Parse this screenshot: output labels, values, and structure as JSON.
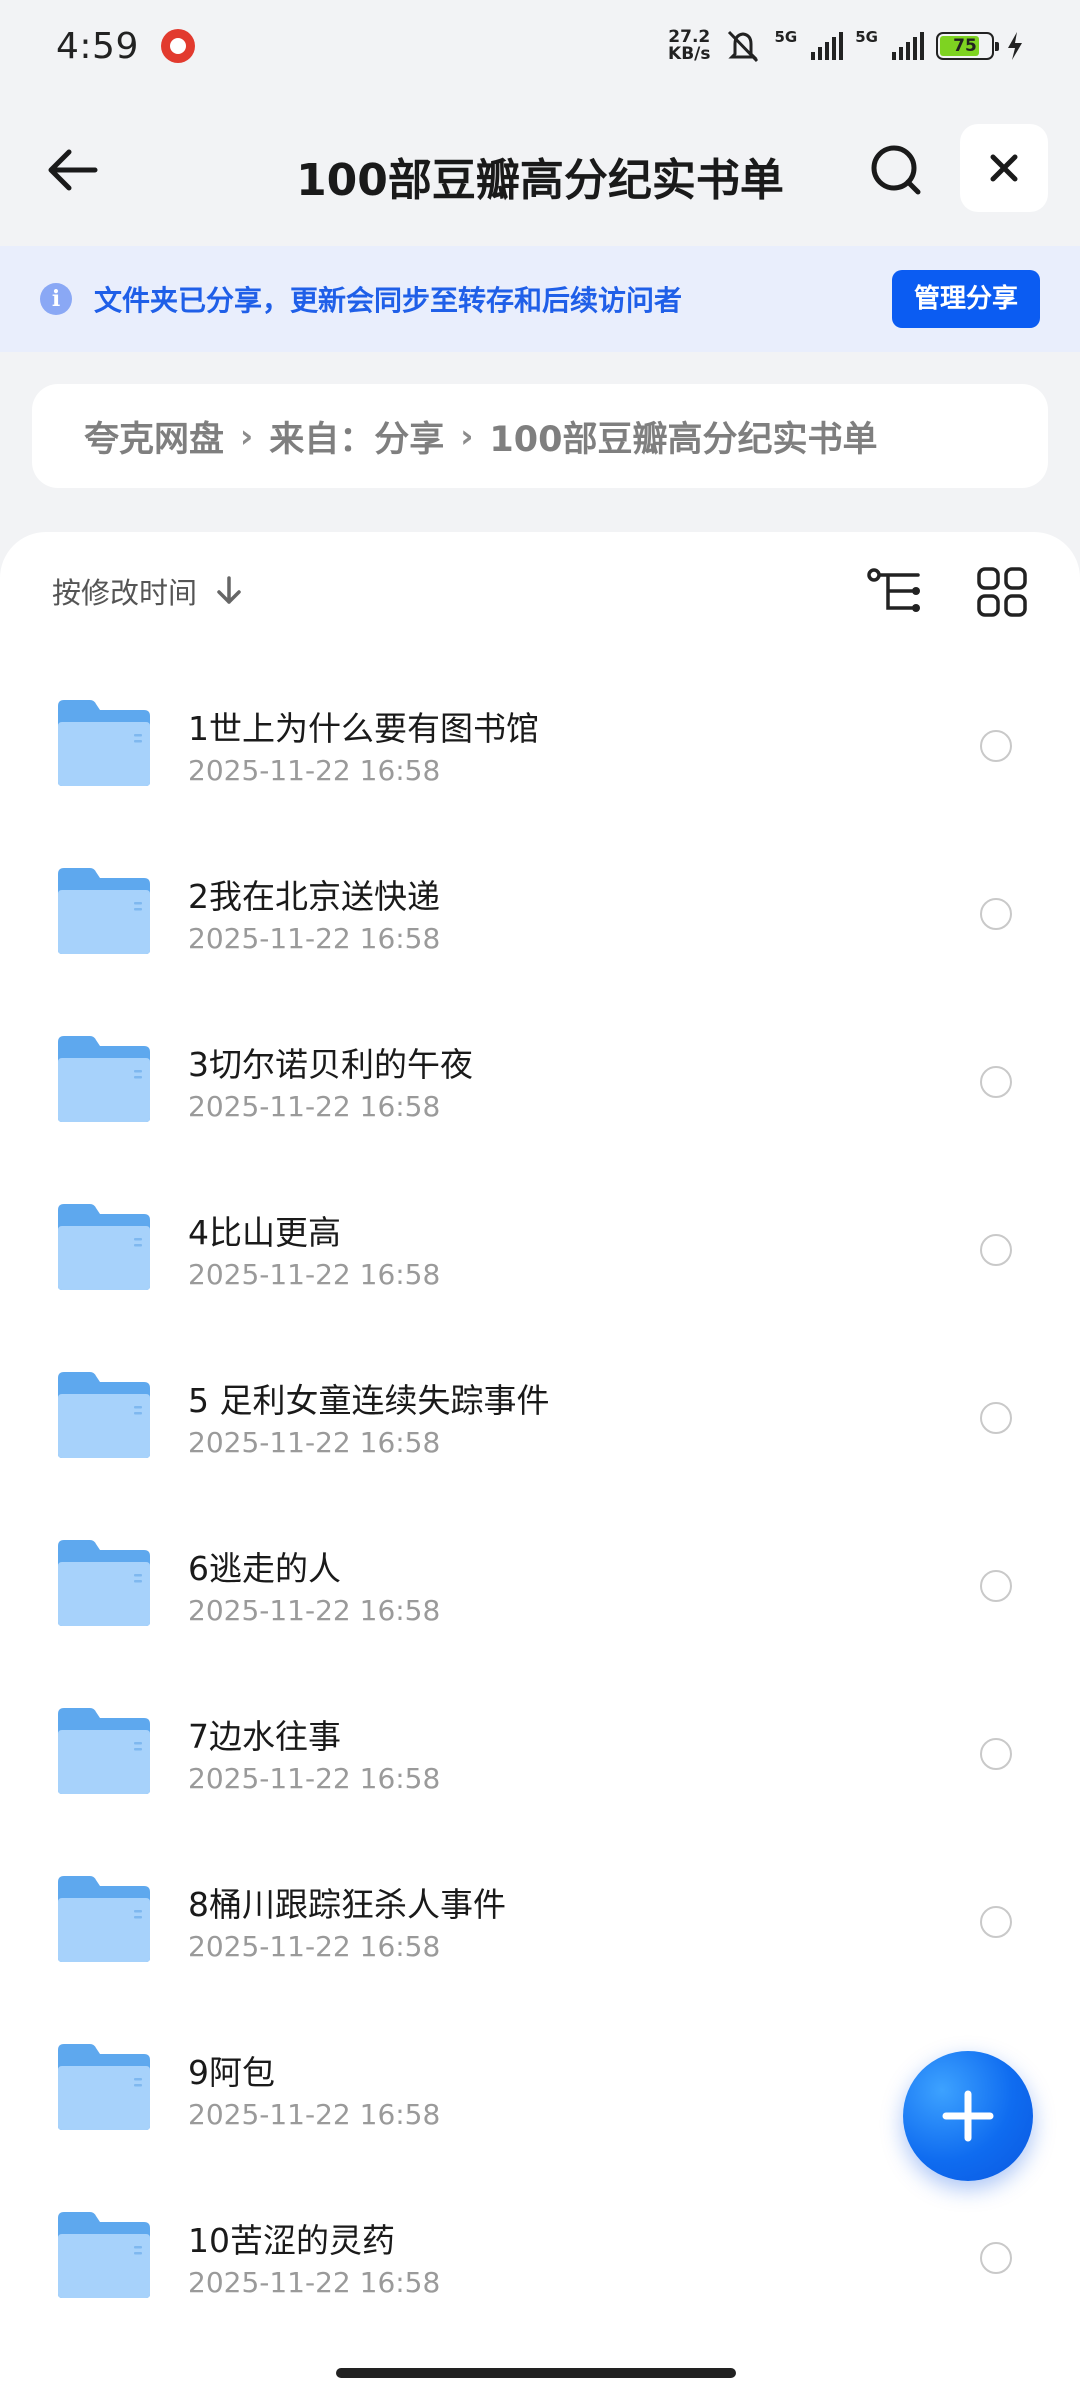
{
  "status_bar": {
    "time": "4:59",
    "net_speed_value": "27.2",
    "net_speed_unit": "KB/s",
    "sim1_label": "5G",
    "sim2_label": "5G",
    "battery_level": "75"
  },
  "header": {
    "title": "100部豆瓣高分纪实书单"
  },
  "share_banner": {
    "message": "文件夹已分享，更新会同步至转存和后续访问者",
    "manage_label": "管理分享"
  },
  "breadcrumb": {
    "items": [
      "夸克网盘",
      "来自：分享",
      "100部豆瓣高分纪实书单"
    ]
  },
  "sort": {
    "label": "按修改时间"
  },
  "files": [
    {
      "name": "1世上为什么要有图书馆",
      "date": "2025-11-22 16:58"
    },
    {
      "name": "2我在北京送快递",
      "date": "2025-11-22 16:58"
    },
    {
      "name": "3切尔诺贝利的午夜",
      "date": "2025-11-22 16:58"
    },
    {
      "name": "4比山更高",
      "date": "2025-11-22 16:58"
    },
    {
      "name": "5 足利女童连续失踪事件",
      "date": "2025-11-22 16:58"
    },
    {
      "name": "6逃走的人",
      "date": "2025-11-22 16:58"
    },
    {
      "name": "7边水往事",
      "date": "2025-11-22 16:58"
    },
    {
      "name": "8桶川跟踪狂杀人事件",
      "date": "2025-11-22 16:58"
    },
    {
      "name": "9阿包",
      "date": "2025-11-22 16:58"
    },
    {
      "name": "10苦涩的灵药",
      "date": "2025-11-22 16:58"
    }
  ],
  "colors": {
    "accent": "#0b5cf2",
    "banner_bg": "#e9eefc",
    "folder": "#5ea8ee"
  },
  "icons": {
    "back": "arrow-left-icon",
    "search": "search-icon",
    "close": "close-icon",
    "info": "info-icon",
    "sort": "arrow-down-icon",
    "tree": "tree-view-icon",
    "grid": "grid-view-icon",
    "folder": "folder-icon",
    "fab": "plus-icon"
  }
}
